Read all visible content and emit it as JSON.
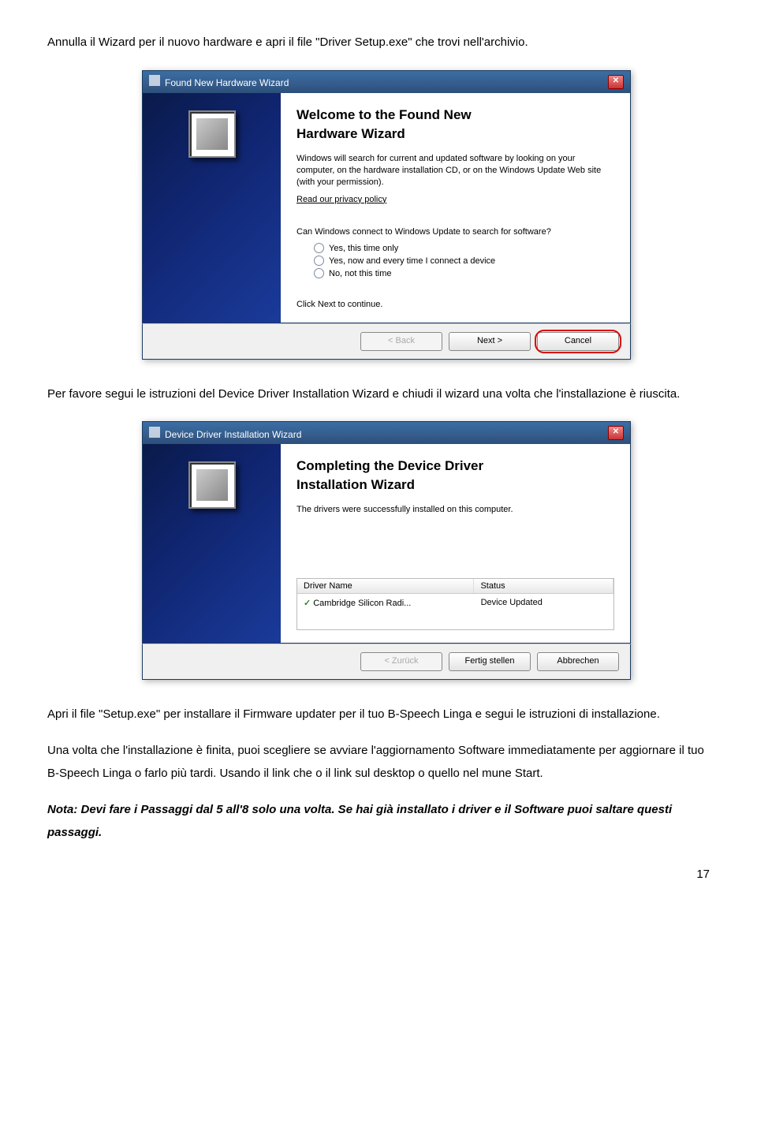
{
  "para1": "Annulla il Wizard per il nuovo hardware e apri il file \"Driver Setup.exe\" che trovi nell'archivio.",
  "wizard1": {
    "title": "Found New Hardware Wizard",
    "heading1": "Welcome to the Found New",
    "heading2": "Hardware Wizard",
    "body1": "Windows will search for current and updated software by looking on your computer, on the hardware installation CD, or on the Windows Update Web site (with your permission).",
    "privacy": "Read our privacy policy",
    "question": "Can Windows connect to Windows Update to search for software?",
    "opt1": "Yes, this time only",
    "opt2": "Yes, now and every time I connect a device",
    "opt3": "No, not this time",
    "continue": "Click Next to continue.",
    "back": "< Back",
    "next": "Next >",
    "cancel": "Cancel"
  },
  "para2": "Per favore segui le istruzioni del Device Driver Installation Wizard e chiudi il wizard una volta che l'installazione è riuscita.",
  "wizard2": {
    "title": "Device Driver Installation Wizard",
    "heading1": "Completing the Device Driver",
    "heading2": "Installation Wizard",
    "body1": "The drivers were successfully installed on this computer.",
    "col1": "Driver Name",
    "col2": "Status",
    "drvname": "Cambridge Silicon Radi...",
    "drvstatus": "Device Updated",
    "back": "< Zurück",
    "finish": "Fertig stellen",
    "cancel": "Abbrechen"
  },
  "para3": "Apri il file \"Setup.exe\" per installare il Firmware updater per il tuo B-Speech Linga e segui le istruzioni di installazione.",
  "para4": "Una volta che l'installazione è finita, puoi scegliere se avviare l'aggiornamento Software immediatamente per aggiornare il tuo B-Speech Linga o farlo più tardi. Usando il link che o il link sul desktop o quello nel mune Start.",
  "note": "Nota: Devi fare i Passaggi dal 5 all'8 solo una volta. Se hai già installato i driver e il Software puoi saltare questi passaggi.",
  "pagenum": "17"
}
